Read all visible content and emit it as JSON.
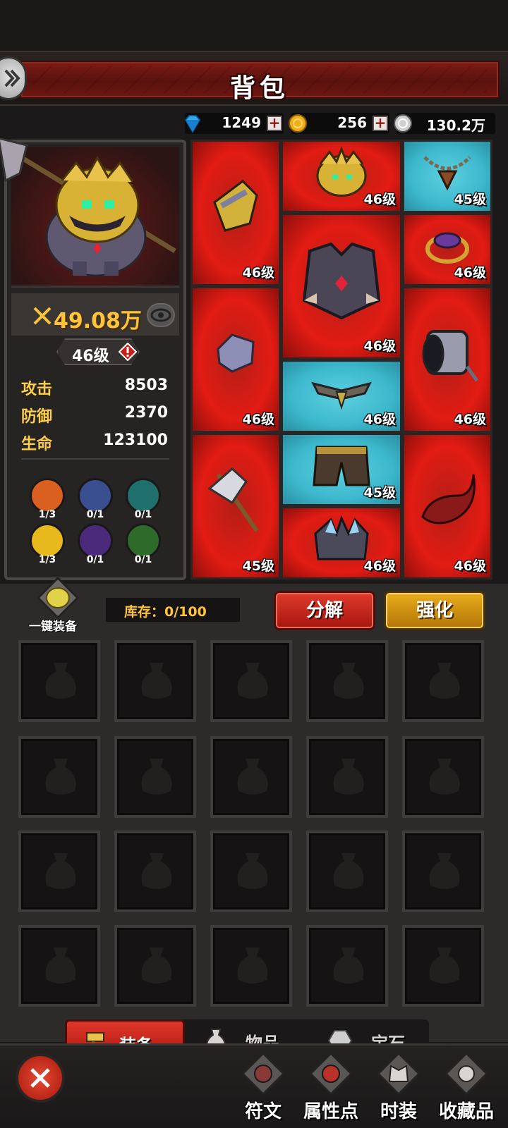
{
  "header": {
    "title": "背包"
  },
  "currency": {
    "gems": "1249",
    "gold": "256",
    "silver": "130.2万"
  },
  "hero": {
    "power": "49.08万",
    "level": "46级",
    "stats": [
      {
        "label": "攻击",
        "value": "8503"
      },
      {
        "label": "防御",
        "value": "2370"
      },
      {
        "label": "生命",
        "value": "123100"
      }
    ],
    "elements": [
      {
        "name": "fire",
        "count": "1/3",
        "color": "#d9601e"
      },
      {
        "name": "lightning",
        "count": "0/1",
        "color": "#3a4f8f"
      },
      {
        "name": "ice",
        "count": "0/1",
        "color": "#1f6f6c"
      },
      {
        "name": "light",
        "count": "1/3",
        "color": "#e8b91c"
      },
      {
        "name": "shadow",
        "count": "0/1",
        "color": "#4b2a7c"
      },
      {
        "name": "nature",
        "count": "0/1",
        "color": "#2e6a2a"
      }
    ]
  },
  "equipment": [
    {
      "slot": "shoulder",
      "level": "46级",
      "rarity": "red"
    },
    {
      "slot": "helmet",
      "level": "46级",
      "rarity": "red"
    },
    {
      "slot": "necklace",
      "level": "45级",
      "rarity": "cyan"
    },
    {
      "slot": "chest",
      "level": "46级",
      "rarity": "red"
    },
    {
      "slot": "ring",
      "level": "46级",
      "rarity": "red"
    },
    {
      "slot": "glove",
      "level": "46级",
      "rarity": "red"
    },
    {
      "slot": "belt",
      "level": "46级",
      "rarity": "cyan"
    },
    {
      "slot": "bracer",
      "level": "46级",
      "rarity": "red"
    },
    {
      "slot": "weapon",
      "level": "45级",
      "rarity": "red"
    },
    {
      "slot": "pants",
      "level": "45级",
      "rarity": "cyan"
    },
    {
      "slot": "boots",
      "level": "46级",
      "rarity": "red"
    },
    {
      "slot": "horn",
      "level": "46级",
      "rarity": "red"
    }
  ],
  "bag": {
    "quick_equip_label": "一键装备",
    "inventory": "库存：0/100",
    "decompose_label": "分解",
    "enhance_label": "强化"
  },
  "tabs": [
    {
      "label": "装备",
      "icon": "hammer-icon",
      "active": true
    },
    {
      "label": "物品",
      "icon": "sack-icon",
      "active": false
    },
    {
      "label": "宝石",
      "icon": "gem-icon",
      "active": false
    }
  ],
  "nav": [
    {
      "label": "符文",
      "icon": "rune-icon"
    },
    {
      "label": "属性点",
      "icon": "attribute-icon"
    },
    {
      "label": "时装",
      "icon": "costume-icon"
    },
    {
      "label": "收藏品",
      "icon": "collection-icon"
    }
  ]
}
